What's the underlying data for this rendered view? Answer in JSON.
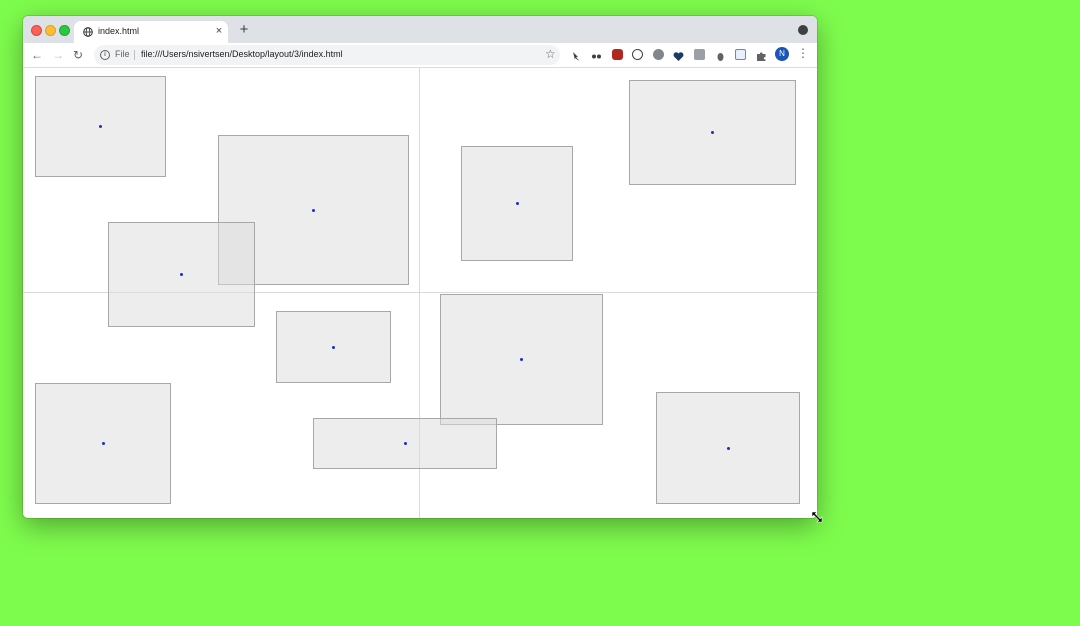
{
  "browser": {
    "tab": {
      "title": "index.html",
      "close_icon": "×"
    },
    "new_tab_icon": "+",
    "toolbar": {
      "back_icon": "←",
      "forward_icon": "→",
      "reload_icon": "↻",
      "scheme_label": "File",
      "url": "file:///Users/nsivertsen/Desktop/layout/3/index.html",
      "star_icon": "☆",
      "avatar_initial": "N",
      "menu_icon": "⋮"
    },
    "extension_icons": [
      "pin-icon",
      "link-icon",
      "shield-icon",
      "info-circle-icon",
      "moon-icon",
      "heart-icon",
      "tile-icon",
      "bug-icon",
      "card-icon",
      "puzzle-icon"
    ]
  },
  "page": {
    "boxes_count": 10,
    "dot_color": "#1f2bd8",
    "guide_color": "#d9d9d9"
  },
  "colors": {
    "desktop_background": "#7efc4d",
    "tabstrip": "#dee1e6",
    "omnibox": "#f1f3f4",
    "avatar": "#1a56b8"
  }
}
